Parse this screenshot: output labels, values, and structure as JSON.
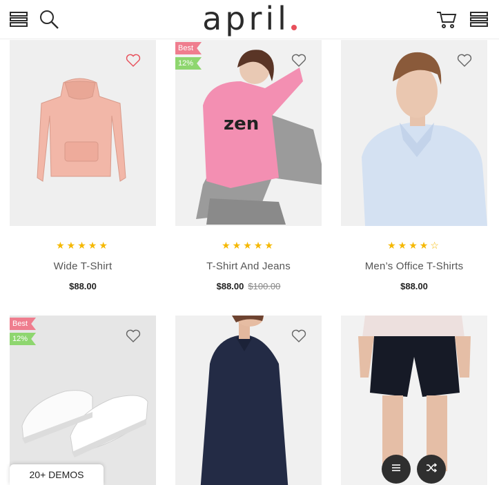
{
  "header": {
    "logo_text": "april"
  },
  "products": [
    {
      "name": "Wide T-Shirt",
      "price": "$88.00",
      "old_price": "",
      "stars": "★★★★★",
      "rating": 5,
      "tags": []
    },
    {
      "name": "T-Shirt And Jeans",
      "price": "$88.00",
      "old_price": "$100.00",
      "stars": "★★★★★",
      "rating": 5,
      "tags": [
        "Best",
        "12%"
      ]
    },
    {
      "name": "Men’s Office T-Shirts",
      "price": "$88.00",
      "old_price": "",
      "stars": "★★★★☆",
      "rating": 4,
      "tags": []
    },
    {
      "tags": [
        "Best",
        "12%"
      ]
    },
    {
      "tags": []
    },
    {
      "tags": []
    }
  ],
  "footer": {
    "demos_label": "20+ DEMOS"
  },
  "colors": {
    "accent_dot": "#e8505b",
    "tag_best": "#ef7d8e",
    "tag_sale": "#8ed66f",
    "star": "#f5b800"
  }
}
